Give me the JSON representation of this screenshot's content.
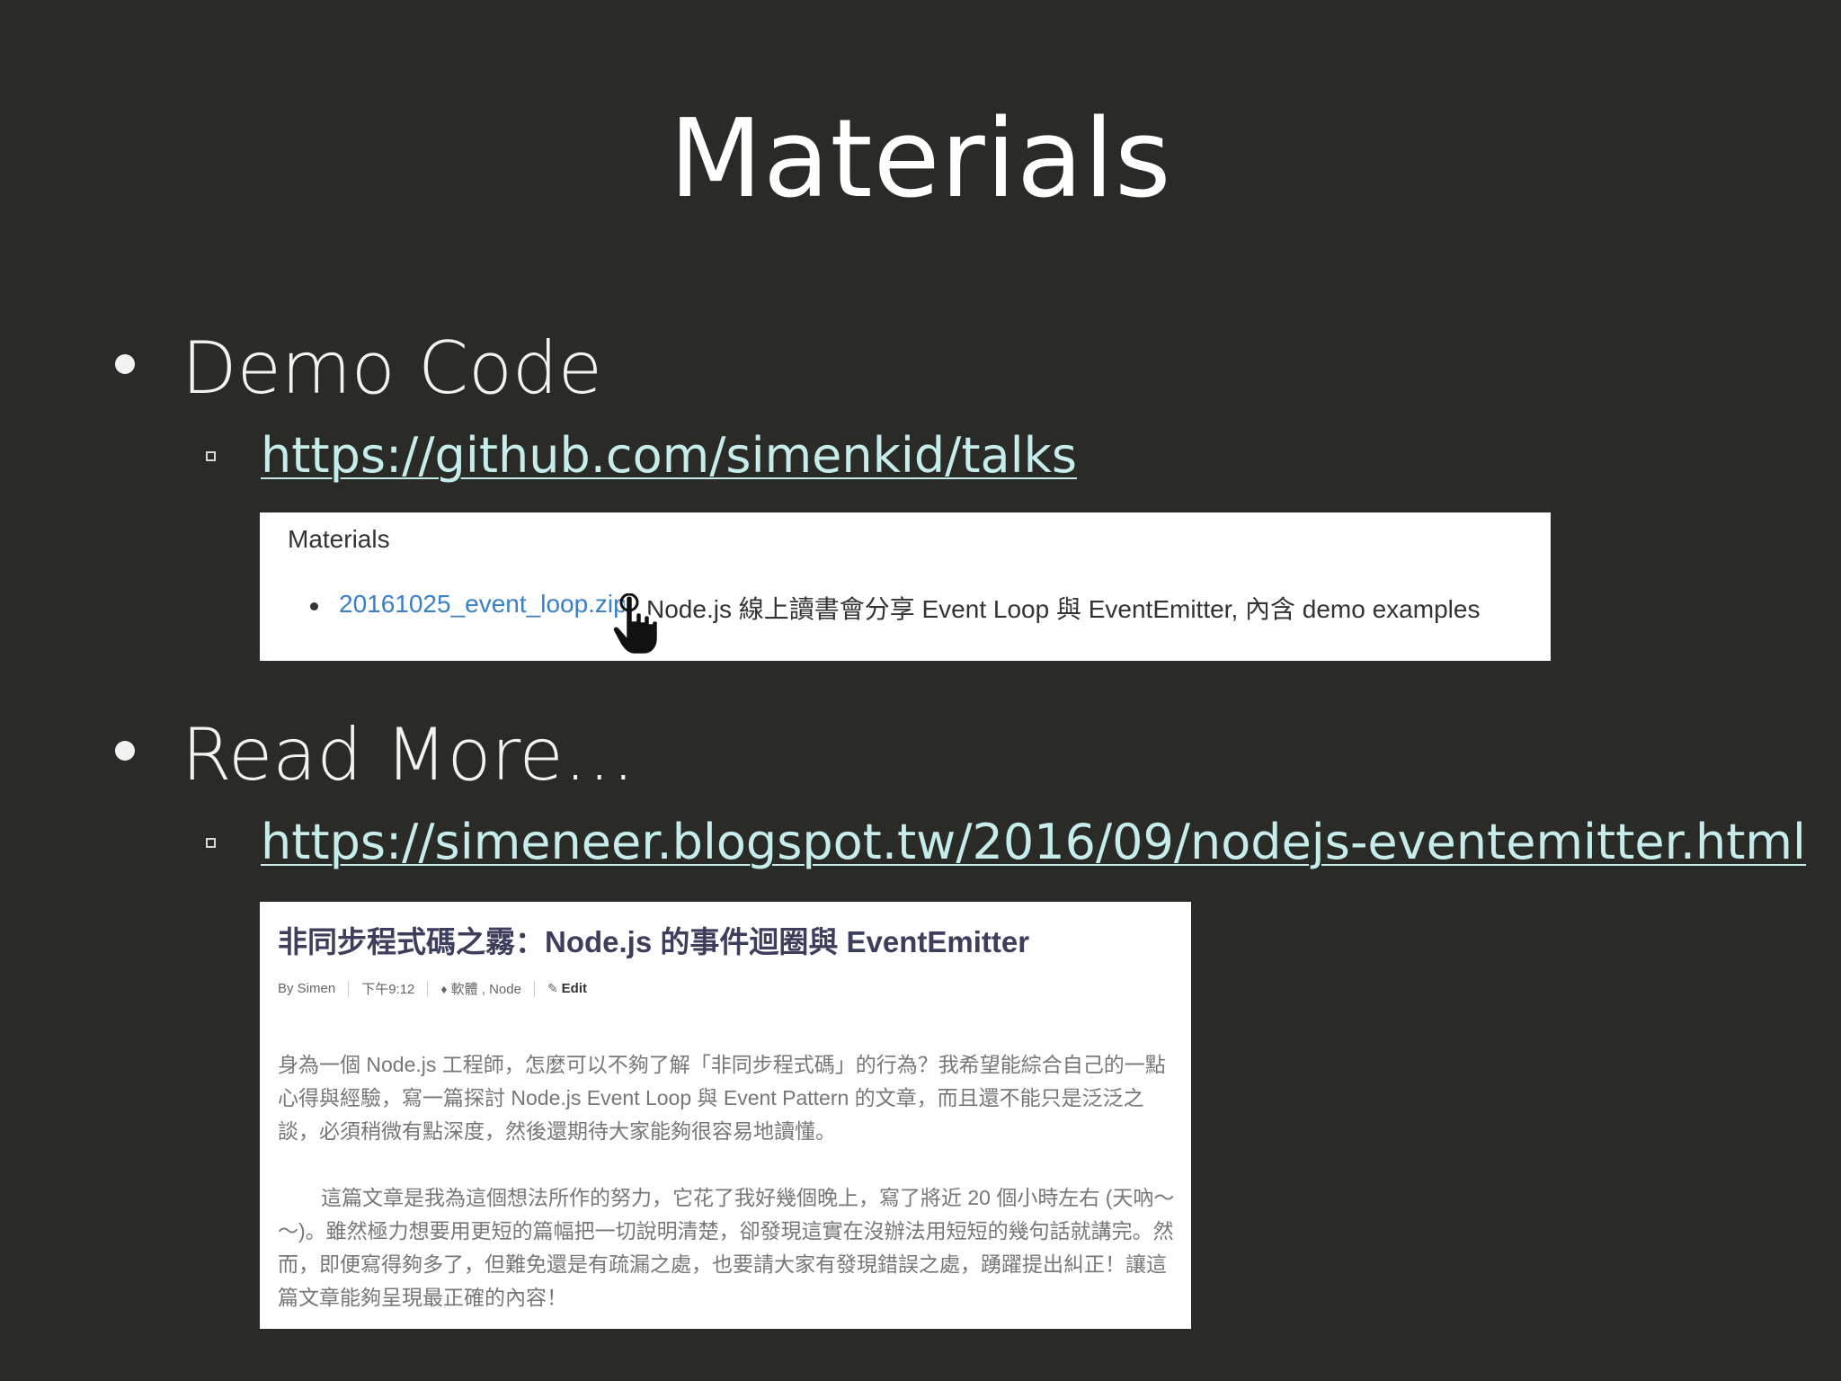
{
  "slide": {
    "title": "Materials"
  },
  "sections": [
    {
      "heading": "Demo Code",
      "link": "https://github.com/simenkid/talks"
    },
    {
      "heading": "Read More…",
      "link": "https://simeneer.blogspot.tw/2016/09/nodejs-eventemitter.html"
    }
  ],
  "screenshot_materials": {
    "heading": "Materials",
    "item_link": "20161025_event_loop.zip",
    "item_desc": "Node.js 線上讀書會分享 Event Loop 與 EventEmitter, 內含 demo examples"
  },
  "screenshot_blog": {
    "title": "非同步程式碼之霧：Node.js 的事件迴圈與 EventEmitter",
    "meta": {
      "author": "By Simen",
      "time": "下午9:12",
      "labels": "軟體 , Node",
      "edit": "Edit"
    },
    "para1": "身為一個 Node.js 工程師，怎麼可以不夠了解「非同步程式碼」的行為？我希望能綜合自己的一點心得與經驗，寫一篇探討 Node.js Event Loop 與 Event Pattern 的文章，而且還不能只是泛泛之談，必須稍微有點深度，然後還期待大家能夠很容易地讀懂。",
    "para2": "這篇文章是我為這個想法所作的努力，它花了我好幾個晚上，寫了將近 20 個小時左右 (天吶～～)。雖然極力想要用更短的篇幅把一切說明清楚，卻發現這實在沒辦法用短短的幾句話就講完。然而，即便寫得夠多了，但難免還是有疏漏之處，也要請大家有發現錯誤之處，踴躍提出糾正！讓這篇文章能夠呈現最正確的內容！"
  },
  "icons": {
    "bullet": "filled-circle",
    "sub_bullet": "hollow-square",
    "cursor": "hand-pointer-icon",
    "label": "tag-icon",
    "edit": "pencil-icon"
  }
}
